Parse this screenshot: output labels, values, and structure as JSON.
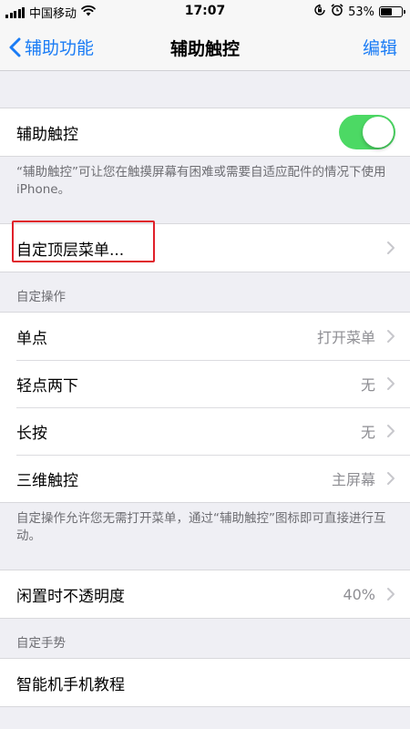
{
  "status_bar": {
    "carrier": "中国移动",
    "time": "17:07",
    "battery_percent": "53%",
    "battery_level": 0.53,
    "icons": [
      "signal-icon",
      "wifi-icon",
      "orientation-lock-icon",
      "alarm-icon",
      "battery-icon"
    ]
  },
  "nav": {
    "back_label": "辅助功能",
    "title": "辅助触控",
    "edit_label": "编辑"
  },
  "assistive_touch": {
    "label": "辅助触控",
    "enabled": true,
    "footnote": "“辅助触控”可让您在触摸屏幕有困难或需要自适应配件的情况下使用 iPhone。"
  },
  "customize_menu": {
    "label": "自定顶层菜单..."
  },
  "custom_actions": {
    "header": "自定操作",
    "items": [
      {
        "label": "单点",
        "value": "打开菜单"
      },
      {
        "label": "轻点两下",
        "value": "无"
      },
      {
        "label": "长按",
        "value": "无"
      },
      {
        "label": "三维触控",
        "value": "主屏幕"
      }
    ],
    "footnote": "自定操作允许您无需打开菜单，通过“辅助触控”图标即可直接进行互动。"
  },
  "idle_opacity": {
    "label": "闲置时不透明度",
    "value": "40%"
  },
  "custom_gestures": {
    "header": "自定手势",
    "items": [
      {
        "label": "智能机手机教程"
      }
    ]
  },
  "colors": {
    "accent": "#1a7cf5",
    "toggle_on": "#4cd964",
    "highlight": "#e0202a"
  }
}
